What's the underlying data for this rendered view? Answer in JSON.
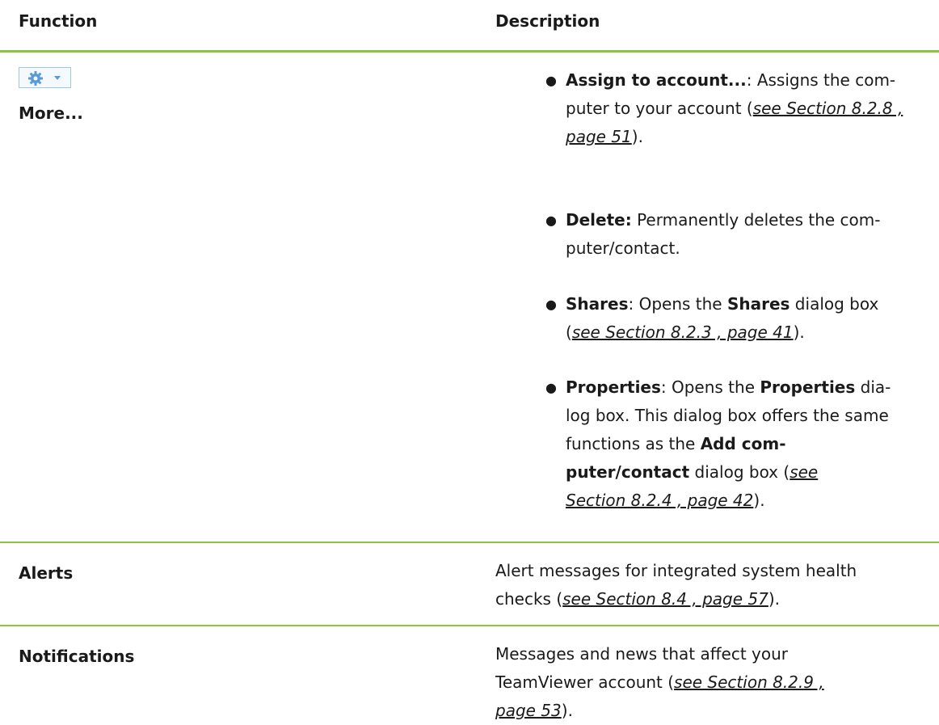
{
  "header": {
    "function": "Function",
    "description": "Description"
  },
  "more": {
    "label": "More...",
    "items": [
      {
        "term": "Assign to account...",
        "sep": ": ",
        "line1": "Assigns the com-",
        "line2": "puter to your account (",
        "ref_a": "see Section 8.2.8 ,",
        "ref_b": "page 51",
        "tail": ")."
      },
      {
        "term": "Delete:",
        "line1": " Permanently deletes the com-",
        "line2": "puter/contact."
      },
      {
        "term": "Shares",
        "mid": ": Opens the ",
        "term2": "Shares",
        "line1end": " dialog box",
        "open": "(",
        "ref": "see Section 8.2.3 , page 41",
        "tail": ")."
      },
      {
        "term": "Properties",
        "mid": ": Opens the ",
        "term2": "Properties",
        "end1": " dia-",
        "line2": "log box. This dialog box offers the same",
        "line3": "functions as the ",
        "term3a": "Add com-",
        "term3b": "puter/contact",
        "line4": " dialog box (",
        "ref_a": "see",
        "ref_b": "Section 8.2.4 , page 42",
        "tail": ")."
      }
    ]
  },
  "alerts": {
    "label": "Alerts",
    "line1": "Alert messages for integrated system health",
    "line2": "checks (",
    "ref": "see Section 8.4 , page 57",
    "tail": ")."
  },
  "notifications": {
    "label": "Notifications",
    "line1": "Messages and news that affect your",
    "line2": "TeamViewer account (",
    "ref_a": "see Section 8.2.9 ,",
    "ref_b": "page 53",
    "tail": ")."
  },
  "icons": {
    "gear": "gear-icon",
    "caret": "chevron-down-icon"
  },
  "colors": {
    "rule": "#8cc63f",
    "gear": "#5b9bd5",
    "button_border": "#9ac9ee"
  }
}
